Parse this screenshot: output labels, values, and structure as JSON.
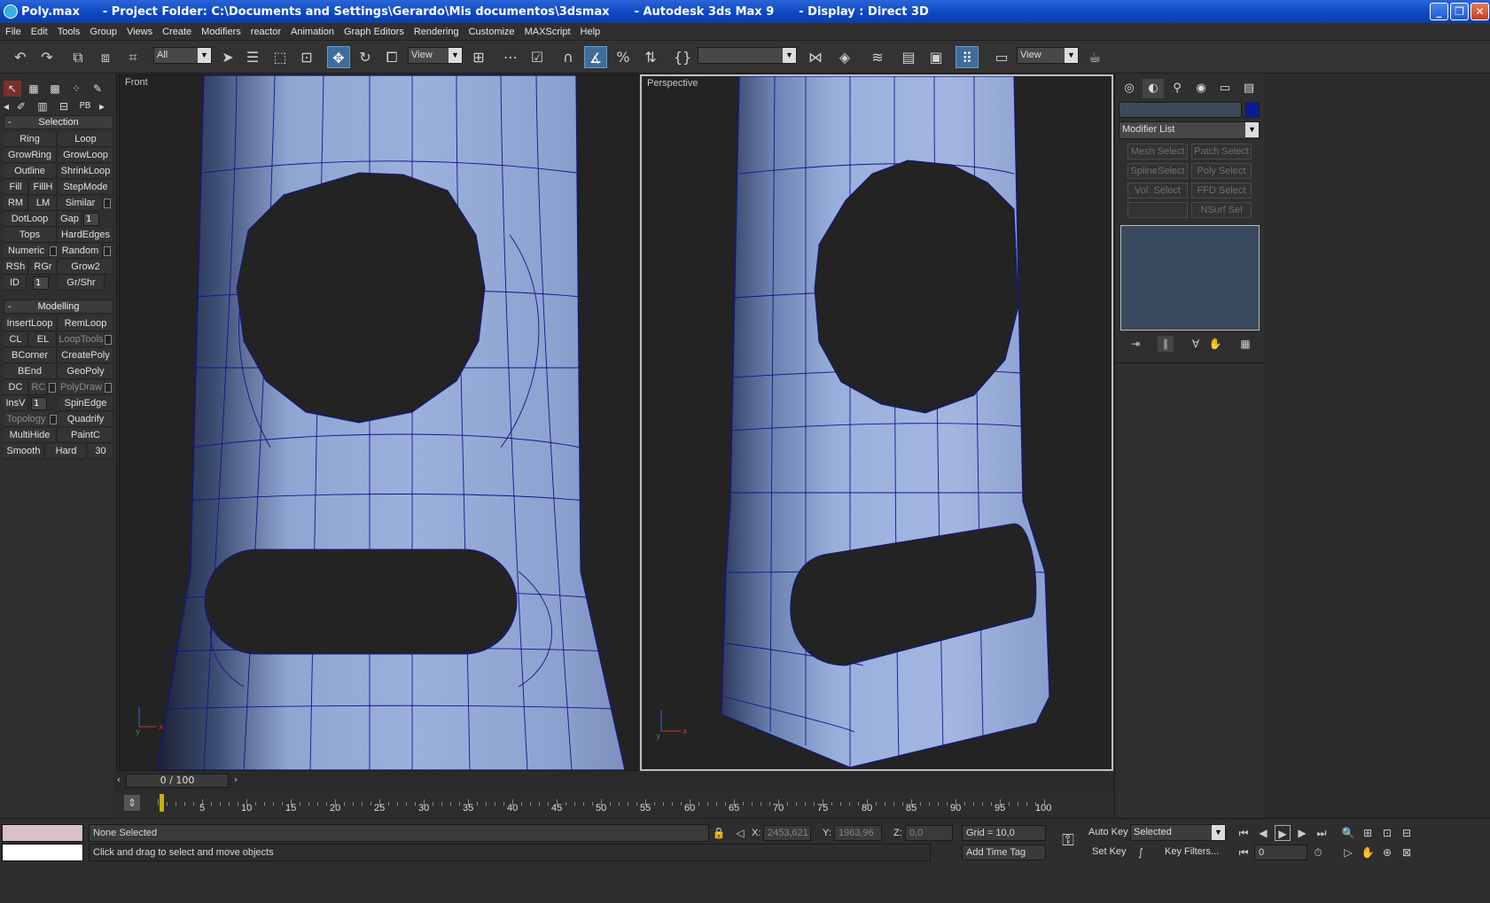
{
  "titlebar": {
    "file": "Poly.max",
    "project": "- Project Folder: C:\\Documents and Settings\\Gerardo\\Mis documentos\\3dsmax",
    "app": "- Autodesk 3ds Max 9",
    "display": "- Display : Direct 3D",
    "controls": {
      "minimize": "_",
      "restore": "❐",
      "close": "✕"
    }
  },
  "menubar": [
    "File",
    "Edit",
    "Tools",
    "Group",
    "Views",
    "Create",
    "Modifiers",
    "reactor",
    "Animation",
    "Graph Editors",
    "Rendering",
    "Customize",
    "MAXScript",
    "Help"
  ],
  "toolbar": {
    "selection_filter": "All",
    "ref_coord_1": "View",
    "named_selection": "",
    "ref_coord_2": "View",
    "active_tool": "move"
  },
  "left_panel": {
    "selection_title": "Selection",
    "selection_buttons": [
      [
        "Ring",
        "Loop"
      ],
      [
        "GrowRing",
        "GrowLoop"
      ],
      [
        "Outline",
        "ShrinkLoop"
      ],
      [
        "Fill",
        "FillH",
        "StepMode"
      ],
      [
        "RM",
        "LM",
        "Similar"
      ],
      [
        "DotLoop",
        "Gap"
      ],
      [
        "Tops",
        "HardEdges"
      ],
      [
        "Numeric",
        "Random"
      ],
      [
        "RSh",
        "RGr",
        "Grow2"
      ],
      [
        "ID",
        "Gr/Shr"
      ]
    ],
    "gap_value": "1",
    "id_value": "1",
    "modelling_title": "Modelling",
    "modelling_buttons": [
      [
        "InsertLoop",
        "RemLoop"
      ],
      [
        "CL",
        "EL",
        "LoopTools"
      ],
      [
        "BCorner",
        "CreatePoly"
      ],
      [
        "BEnd",
        "GeoPoly"
      ],
      [
        "DC",
        "RC",
        "PolyDraw"
      ],
      [
        "InsV",
        "SpinEdge"
      ],
      [
        "Topology",
        "Quadrify"
      ],
      [
        "MultiHide",
        "PaintC"
      ],
      [
        "Smooth",
        "Hard",
        "30"
      ]
    ],
    "insv_value": "1"
  },
  "viewports": {
    "left_label": "Front",
    "right_label": "Perspective",
    "mesh_color": "#8fa8d8",
    "wire_color": "#1a1a8c",
    "hole_color": "#232323"
  },
  "command_panel": {
    "name_field": "",
    "color_swatch": "#0a1a9c",
    "modifier_list": "Modifier List",
    "modifier_buttons": [
      "Mesh Select",
      "Patch Select",
      "SplineSelect",
      "Poly Select",
      "Vol. Select",
      "FFD Select",
      "",
      "NSurf Sel"
    ]
  },
  "timeline": {
    "slider_label": "0 / 100",
    "ticks": [
      0,
      5,
      10,
      15,
      20,
      25,
      30,
      35,
      40,
      45,
      50,
      55,
      60,
      65,
      70,
      75,
      80,
      85,
      90,
      95,
      100
    ]
  },
  "statusbar": {
    "selection": "None Selected",
    "prompt": "Click and drag to select and move objects",
    "x_label": "X:",
    "x_value": "2453,621",
    "y_label": "Y:",
    "y_value": "1963,96",
    "z_label": "Z:",
    "z_value": "0,0",
    "grid": "Grid = 10,0",
    "add_time_tag": "Add Time Tag",
    "auto_key": "Auto Key",
    "set_key": "Set Key",
    "selected_dropdown": "Selected",
    "key_filters": "Key Filters...",
    "frame_value": "0"
  }
}
